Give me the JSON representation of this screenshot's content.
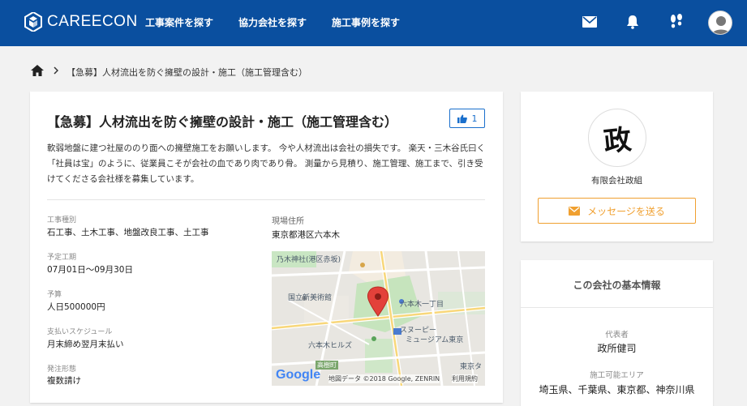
{
  "header": {
    "brand": "CAREECON",
    "nav": [
      "工事案件を探す",
      "協力会社を探す",
      "施工事例を探す"
    ]
  },
  "breadcrumb": {
    "current": "【急募】人材流出を防ぐ擁壁の設計・施工（施工管理含む）"
  },
  "project": {
    "title": "【急募】人材流出を防ぐ擁壁の設計・施工（施工管理含む）",
    "like_count": "1",
    "description": "軟弱地盤に建つ社屋ののり面への擁壁施工をお願いします。 今や人材流出は会社の損失です。 楽天・三木谷氏曰く「社員は宝」のように、従業員こそが会社の血であり肉であり骨。 測量から見積り、施工管理、施工まで、引き受けてくださる会社様を募集しています。",
    "fields": [
      {
        "label": "工事種別",
        "value": "石工事、土木工事、地盤改良工事、土工事"
      },
      {
        "label": "予定工期",
        "value": "07月01日〜09月30日"
      },
      {
        "label": "予算",
        "value": "人日500000円"
      },
      {
        "label": "支払いスケジュール",
        "value": "月末締め翌月末払い"
      },
      {
        "label": "発注形態",
        "value": "複数請け"
      }
    ],
    "location_label": "現場住所",
    "location_value": "東京都港区六本木"
  },
  "map": {
    "labels": [
      "乃木神社(港区赤坂)",
      "国立新美術館",
      "六本木一丁目",
      "六本木ヒルズ",
      "スヌーピー",
      "ミュージアム東京",
      "高樹町",
      "東京タ"
    ],
    "google": "Google",
    "attribution": "地図データ ©2018 Google, ZENRIN",
    "terms": "利用規約"
  },
  "company": {
    "logo_text": "政",
    "name": "有限会社政組",
    "message_button": "メッセージを送る"
  },
  "info": {
    "title": "この会社の基本情報",
    "rep_label": "代表者",
    "rep_value": "政所健司",
    "area_label": "施工可能エリア",
    "area_value": "埼玉県、千葉県、東京都、神奈川県"
  },
  "colors": {
    "header": "#0a4f9f",
    "accent_blue": "#1a6fcc",
    "accent_orange": "#f0a030"
  }
}
